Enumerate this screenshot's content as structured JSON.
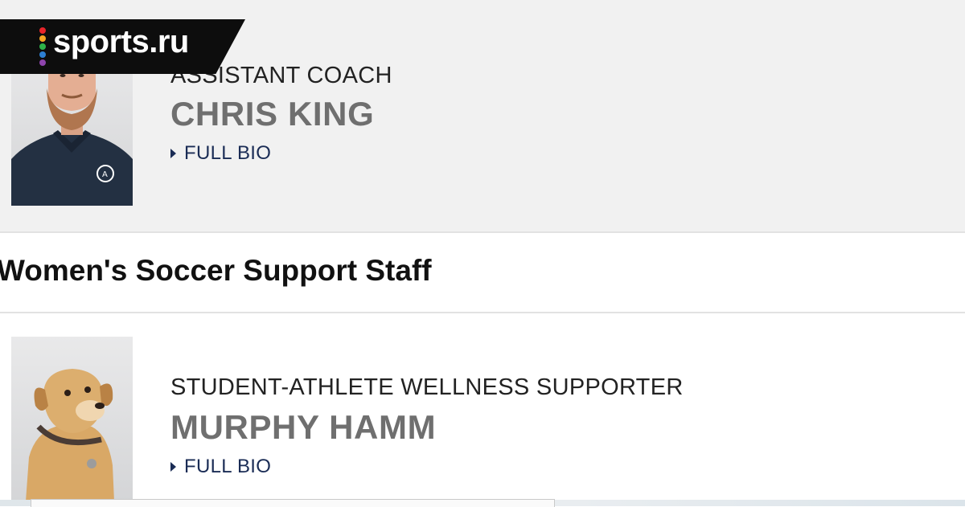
{
  "brand": {
    "logo_text": "sports.ru",
    "logo_dot_colors": [
      "#e8242a",
      "#f5a623",
      "#2fb34a",
      "#2d7fd3",
      "#8e44ad"
    ]
  },
  "coach": {
    "role": "ASSISTANT COACH",
    "name": "CHRIS KING",
    "bio_link": "FULL BIO"
  },
  "section": {
    "title": "Women's Soccer Support Staff"
  },
  "staff": {
    "role": "STUDENT-ATHLETE WELLNESS SUPPORTER",
    "name": "MURPHY HAMM",
    "bio_link": "FULL BIO"
  },
  "colors": {
    "name_grey": "#6f6f6f",
    "link_navy": "#1a2c55",
    "card_bg": "#f1f1f1"
  }
}
